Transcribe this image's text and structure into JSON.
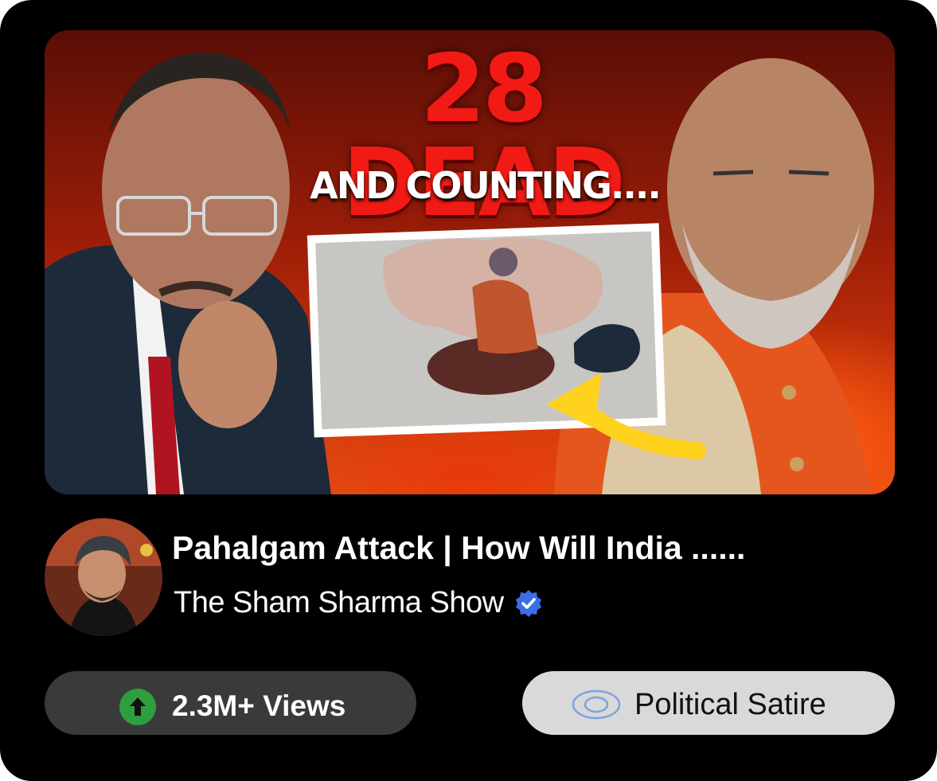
{
  "thumbnail": {
    "headline_number": "28 DEAD",
    "headline_sub": "AND COUNTING...."
  },
  "video": {
    "title": "Pahalgam Attack | How Will India ......",
    "channel": "The Sham Sharma Show",
    "channel_verified": true
  },
  "stats": {
    "views_label": "2.3M+ Views",
    "views_icon": "arrow-up-circle-icon",
    "views_icon_color": "#2e9e3f"
  },
  "tag": {
    "label": "Political Satire",
    "icon": "eye-icon",
    "icon_color": "#7da2e0"
  },
  "colors": {
    "card_bg": "#000000",
    "headline_red": "#f21a14",
    "verified_blue": "#3a6ee8"
  }
}
